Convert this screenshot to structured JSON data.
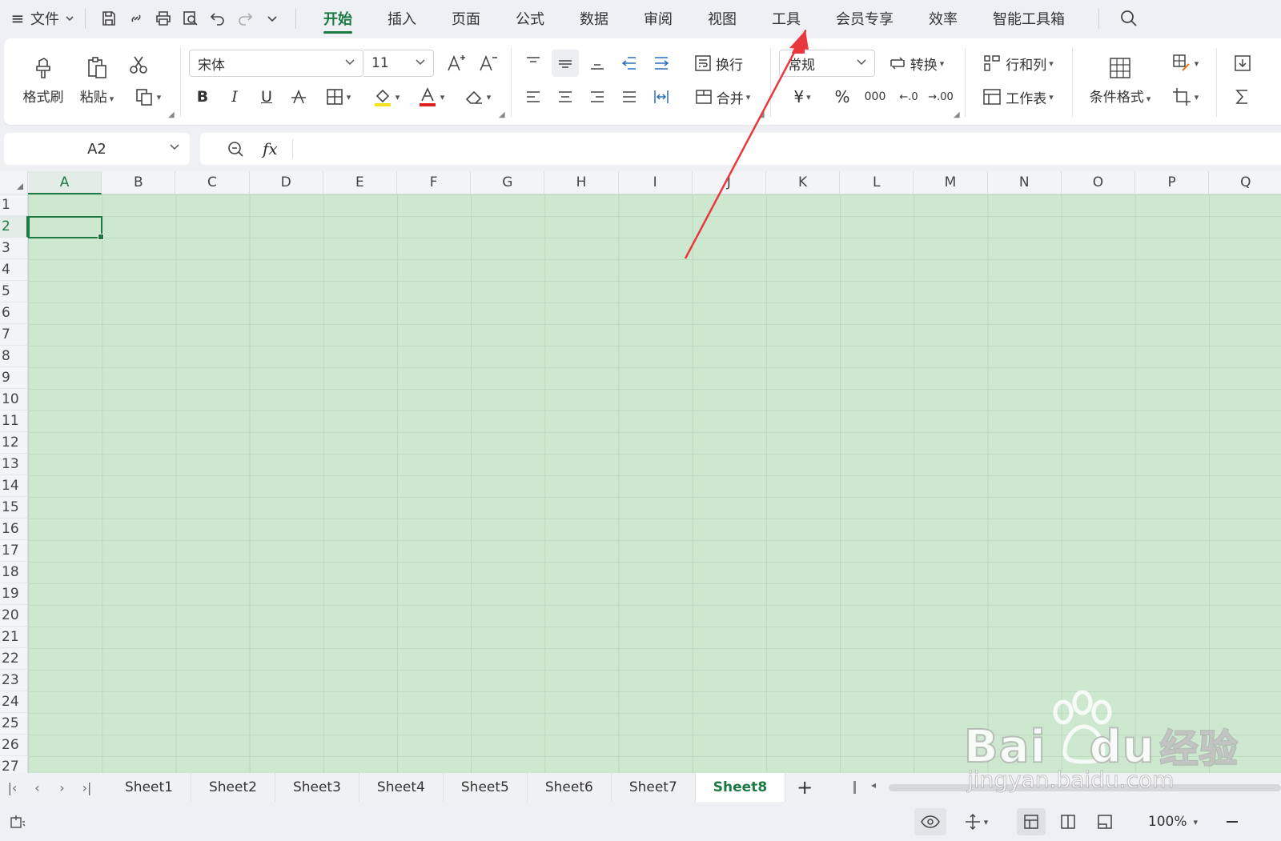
{
  "menubar": {
    "menu_icon": "≡",
    "file_label": "文件",
    "tabs": [
      {
        "label": "开始",
        "active": true
      },
      {
        "label": "插入"
      },
      {
        "label": "页面"
      },
      {
        "label": "公式"
      },
      {
        "label": "数据"
      },
      {
        "label": "审阅"
      },
      {
        "label": "视图"
      },
      {
        "label": "工具"
      },
      {
        "label": "会员专享"
      },
      {
        "label": "效率"
      },
      {
        "label": "智能工具箱"
      }
    ]
  },
  "ribbon": {
    "format_painter": "格式刷",
    "paste": "粘贴",
    "font_name": "宋体",
    "font_size": "11",
    "bold": "B",
    "italic": "I",
    "underline": "U",
    "wrap": "换行",
    "merge": "合并",
    "number_format": "常规",
    "convert": "转换",
    "rows_cols": "行和列",
    "worksheet": "工作表",
    "cond_format": "条件格式",
    "currency": "¥",
    "percent": "%",
    "thousands": "000",
    "dec_inc": "←.0",
    "dec_dec": "→.00"
  },
  "formula_bar": {
    "name_box": "A2",
    "fx": "fx",
    "value": ""
  },
  "grid": {
    "columns": [
      "A",
      "B",
      "C",
      "D",
      "E",
      "F",
      "G",
      "H",
      "I",
      "J",
      "K",
      "L",
      "M",
      "N",
      "O",
      "P",
      "Q"
    ],
    "rows": [
      "1",
      "2",
      "3",
      "4",
      "5",
      "6",
      "7",
      "8",
      "9",
      "10",
      "11",
      "12",
      "13",
      "14",
      "15",
      "16",
      "17",
      "18",
      "19",
      "20",
      "21",
      "22",
      "23",
      "24",
      "25",
      "26",
      "27"
    ],
    "selected_column": "A",
    "selected_row": "2",
    "fill_color": "#cde8cf"
  },
  "sheets": {
    "tabs": [
      "Sheet1",
      "Sheet2",
      "Sheet3",
      "Sheet4",
      "Sheet5",
      "Sheet6",
      "Sheet7",
      "Sheet8"
    ],
    "active": "Sheet8",
    "add": "+"
  },
  "statusbar": {
    "zoom": "100%"
  },
  "colors": {
    "accent": "#1b7a43",
    "arrow": "#e8383d"
  },
  "watermark": {
    "brand": "Bai",
    "brand2": "du",
    "suffix": "经验",
    "url": "jingyan.baidu.com"
  }
}
